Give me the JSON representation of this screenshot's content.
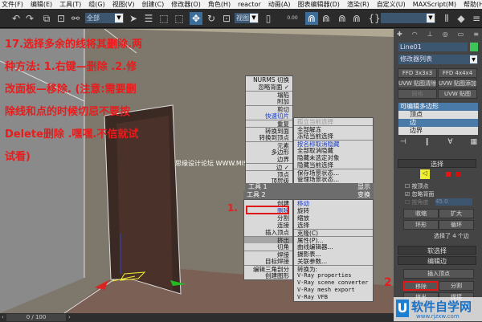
{
  "menu": [
    "文件(F)",
    "编辑(E)",
    "工具(T)",
    "组(G)",
    "视图(V)",
    "创建(C)",
    "修改器(O)",
    "角色(H)",
    "reactor",
    "动画(A)",
    "图表编辑器(D)",
    "渲染(R)",
    "自定义(U)",
    "MAXScript(M)",
    "帮助(H)"
  ],
  "toolbar": {
    "selection_filter": "全部",
    "view_combo": "视图",
    "spinner_value": "0.00"
  },
  "annotation": {
    "text": "17.选择多余的线将其删除.两种方法: 1.右键—删除 .2.修改面板—移除. (注意:需要删除线和点的时候切忌不要按Delete删除 .嘿嘿.不信就试试看)",
    "marker1": "1.",
    "marker2": "2"
  },
  "watermark": "思缘设计论坛 WWW.MISSYUAN.COM",
  "quad_menu": {
    "left_top": [
      "NURMS 切换",
      "忽略背面 ✓",
      "塌陷",
      "附加",
      "剪切",
      "快速切片",
      "重复",
      "转换到面",
      "转换到顶点",
      "元素",
      "多边形",
      "边界",
      "边 ✓",
      "顶点",
      "顶层级"
    ],
    "right_top": [
      "孤立当前选择",
      "全部解冻",
      "冻结当前选择",
      "按名称取消隐藏",
      "全部取消隐藏",
      "隐藏未选定对象",
      "隐藏当前选择",
      "保存场景状态...",
      "管理场景状态..."
    ],
    "tools1": "工具 1",
    "display": "显示",
    "tools2": "工具 2",
    "transform": "变换",
    "left_bottom": [
      "创建",
      "删除",
      "分割",
      "连接",
      "插入顶点",
      "挤出",
      "切角",
      "焊接",
      "目标焊接",
      "编辑三角剖分",
      "创建图形"
    ],
    "right_bottom": [
      "移动",
      "旋转",
      "缩放",
      "选择",
      "克隆(C)",
      "属性(P)...",
      "曲线编辑器...",
      "摄影表...",
      "关联参数...",
      "转换为:",
      "V-Ray properties",
      "V-Ray scene converter",
      "V-Ray mesh export",
      "V-Ray VFB"
    ]
  },
  "panel": {
    "object_name": "Line01",
    "object_color": "#3cc45a",
    "modifier_list": "修改器列表",
    "buttons": [
      "FFD 3x3x3",
      "FFD 4x4x4",
      "UVW 贴图清除",
      "UVW 贴图添加",
      "网格",
      "UVW 贴图"
    ],
    "stack": [
      "可编辑多边形",
      "顶点",
      "边",
      "边界"
    ],
    "select_rollout": "选择",
    "by_vertex": "按顶点",
    "ignore_backfacing": "忽略背面",
    "by_angle": "按角度",
    "angle_value": "45.0",
    "shrink": "收缩",
    "grow": "扩大",
    "ring": "环形",
    "loop": "循环",
    "selection_status": "选择了 4 个边",
    "soft_select": "软选择",
    "edit_edges": "编辑边",
    "insert_vertex": "插入顶点",
    "remove": "移除",
    "split": "分割",
    "extrude": "挤出",
    "weld": "焊接"
  },
  "timeline": "0 / 100",
  "logo": {
    "text": "软件自学网",
    "url": "www.rjzxw.com"
  }
}
